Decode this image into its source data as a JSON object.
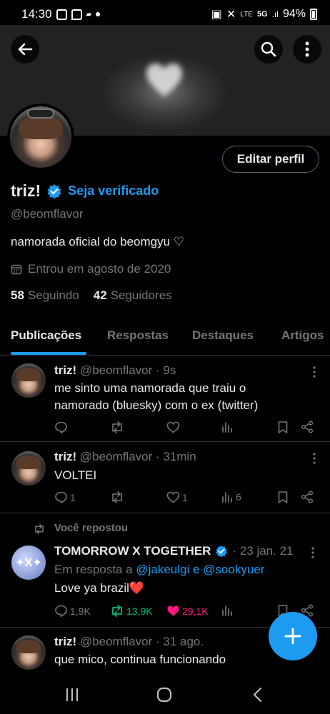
{
  "status_bar": {
    "time": "14:30",
    "network": "5G",
    "battery": "94%"
  },
  "profile": {
    "name": "triz!",
    "verify_link": "Seja verificado",
    "handle": "@beomflavor",
    "bio": "namorada oficial do beomgyu ♡",
    "joined": "Entrou em agosto de 2020",
    "following_count": "58",
    "following_label": "Seguindo",
    "followers_count": "42",
    "followers_label": "Seguidores",
    "edit_button": "Editar perfil"
  },
  "tabs": [
    {
      "label": "Publicações",
      "active": true
    },
    {
      "label": "Respostas",
      "active": false
    },
    {
      "label": "Destaques",
      "active": false
    },
    {
      "label": "Artigos",
      "active": false
    }
  ],
  "posts": [
    {
      "name": "triz!",
      "handle": "@beomflavor · 9s",
      "text_1": "me sinto uma namorada que traiu o",
      "text_2": "namorado (bluesky) com o ex (twitter)",
      "replies": "",
      "reposts": "",
      "likes": "",
      "views": ""
    },
    {
      "name": "triz!",
      "handle": "@beomflavor · 31min",
      "text_1": "VOLTEI",
      "replies": "1",
      "reposts": "",
      "likes": "1",
      "views": "6"
    },
    {
      "repost_label": "Você repostou",
      "name": "TOMORROW X TOGETHER",
      "time": "· 23 jan. 21",
      "avatar_text": "✦X✦",
      "reply_prefix": "Em resposta a",
      "reply_to": "@jakeulgi e @sookyuer",
      "text_1": "Love ya brazil❤️",
      "replies": "1,9K",
      "reposts": "13,9K",
      "likes": "29,1K"
    },
    {
      "name": "triz!",
      "handle": "@beomflavor · 31 ago.",
      "text_1": "que mico, continua funcionando"
    }
  ],
  "colors": {
    "accent": "#1d9bf0",
    "muted": "#71767b",
    "repost_green": "#00ba7c",
    "like_pink": "#f91880"
  }
}
